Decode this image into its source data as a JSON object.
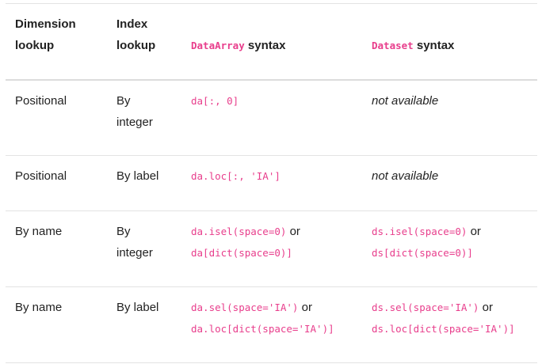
{
  "headers": {
    "dimension": [
      "Dimension",
      "lookup"
    ],
    "index": [
      "Index",
      "lookup"
    ],
    "dataarray_code": "DataArray",
    "dataarray_word": " syntax",
    "dataset_code": "Dataset",
    "dataset_word": " syntax"
  },
  "rows": [
    {
      "dimension": "Positional",
      "index": [
        "By",
        "integer"
      ],
      "dataarray": {
        "line1_code": "da[:, 0]"
      },
      "dataset": {
        "text": "not available"
      }
    },
    {
      "dimension": "Positional",
      "index": [
        "By label"
      ],
      "dataarray": {
        "line1_code": "da.loc[:, 'IA']"
      },
      "dataset": {
        "text": "not available"
      }
    },
    {
      "dimension": "By name",
      "index": [
        "By",
        "integer"
      ],
      "dataarray": {
        "line1_code": "da.isel(space=0)",
        "or": " or",
        "line2_code": "da[dict(space=0)]"
      },
      "dataset": {
        "line1_code": "ds.isel(space=0)",
        "or": " or",
        "line2_code": "ds[dict(space=0)]"
      }
    },
    {
      "dimension": "By name",
      "index": [
        "By label"
      ],
      "dataarray": {
        "line1_code": "da.sel(space='IA')",
        "or": " or",
        "line2_code": "da.loc[dict(space='IA')]"
      },
      "dataset": {
        "line1_code": "ds.sel(space='IA')",
        "or": " or",
        "line2_code": "ds.loc[dict(space='IA')]"
      }
    }
  ]
}
